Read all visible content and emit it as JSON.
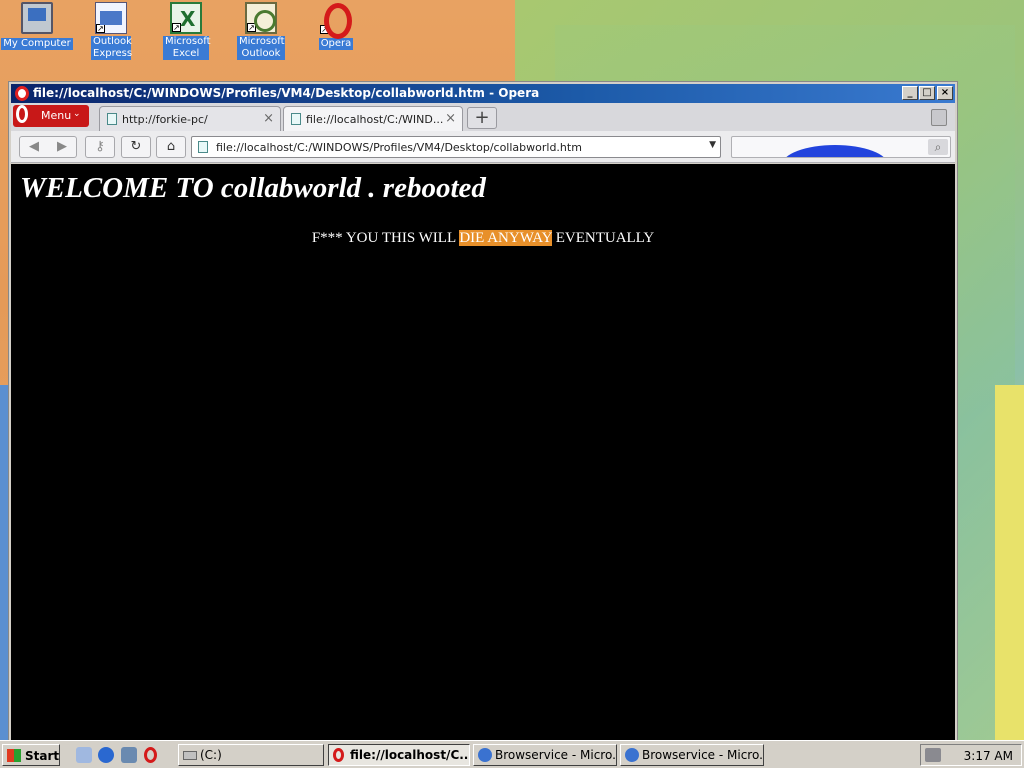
{
  "desktop": {
    "icons": [
      {
        "label": "My Computer",
        "icon": "my-computer-icon"
      },
      {
        "label": "Outlook Express",
        "icon": "outlook-express-icon"
      },
      {
        "label": "Microsoft Excel",
        "icon": "excel-icon"
      },
      {
        "label": "Microsoft Outlook",
        "icon": "outlook-icon"
      },
      {
        "label": "Opera",
        "icon": "opera-icon"
      }
    ]
  },
  "window": {
    "title": "file://localhost/C:/WINDOWS/Profiles/VM4/Desktop/collabworld.htm - Opera",
    "menu_label": "Menu",
    "tabs": [
      {
        "label": "http://forkie-pc/",
        "active": false
      },
      {
        "label": "file://localhost/C:/WIND...",
        "active": true
      }
    ],
    "address": "file://localhost/C:/WINDOWS/Profiles/VM4/Desktop/collabworld.htm",
    "colors": {
      "titlebar": "#0a246a",
      "menu": "#c81818",
      "page_bg": "#000000",
      "highlight": "#e8902a"
    }
  },
  "page": {
    "heading": "WELCOME TO collabworld . rebooted",
    "line_before": "F*** YOU THIS WILL ",
    "line_selected": "DIE ANYWAY",
    "line_after": " EVENTUALLY"
  },
  "taskbar": {
    "start_label": "Start",
    "buttons": [
      {
        "label": "(C:)",
        "active": false
      },
      {
        "label": "file://localhost/C...",
        "active": true
      },
      {
        "label": "Browservice - Micro...",
        "active": false
      },
      {
        "label": "Browservice - Micro...",
        "active": false
      }
    ],
    "clock": "3:17 AM"
  }
}
